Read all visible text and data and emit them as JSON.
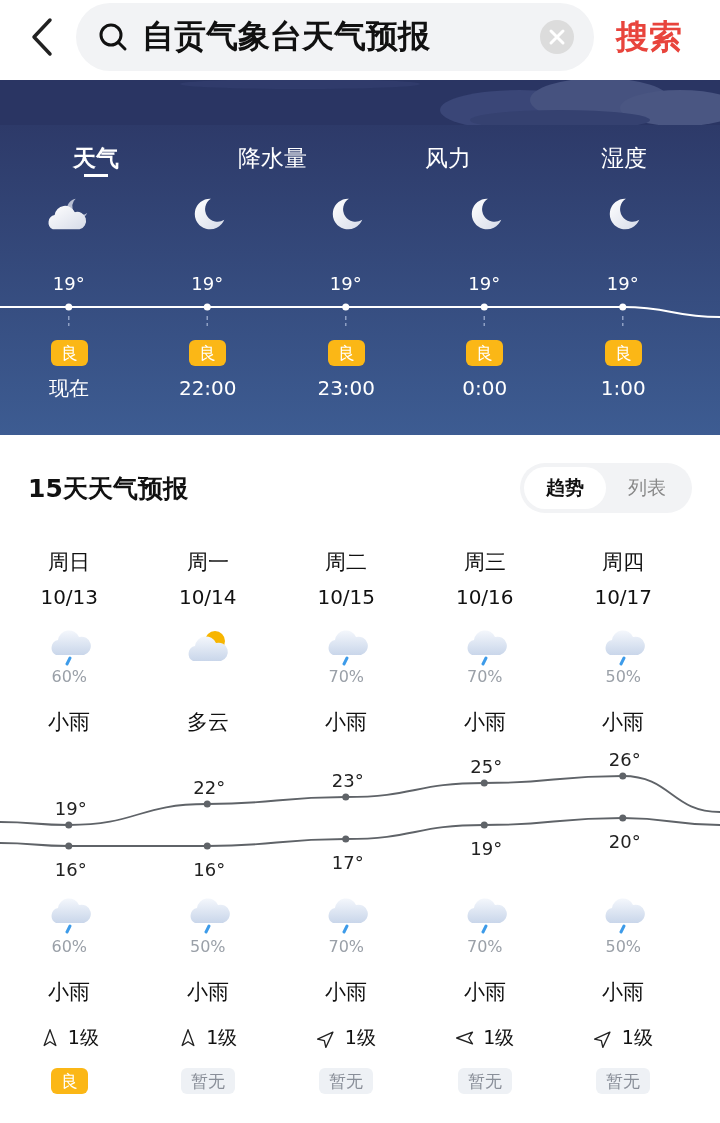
{
  "search_bar": {
    "value": "自贡气象台天气预报",
    "button": "搜索"
  },
  "hourly": {
    "tabs": [
      {
        "label": "天气",
        "selected": true
      },
      {
        "label": "降水量",
        "selected": false
      },
      {
        "label": "风力",
        "selected": false
      },
      {
        "label": "湿度",
        "selected": false
      }
    ],
    "hours": [
      {
        "kind": "cloudy_moon",
        "temp": "19°",
        "aqi": {
          "text": "良",
          "kind": "good"
        },
        "time": "现在"
      },
      {
        "kind": "moon",
        "temp": "19°",
        "aqi": {
          "text": "良",
          "kind": "good"
        },
        "time": "22:00"
      },
      {
        "kind": "moon",
        "temp": "19°",
        "aqi": {
          "text": "良",
          "kind": "good"
        },
        "time": "23:00"
      },
      {
        "kind": "moon",
        "temp": "19°",
        "aqi": {
          "text": "良",
          "kind": "good"
        },
        "time": "0:00"
      },
      {
        "kind": "moon",
        "temp": "19°",
        "aqi": {
          "text": "良",
          "kind": "good"
        },
        "time": "1:00"
      }
    ]
  },
  "forecast": {
    "title": "15天天气预报",
    "view_toggle": [
      {
        "label": "趋势",
        "selected": true
      },
      {
        "label": "列表",
        "selected": false
      }
    ],
    "days": [
      {
        "weekday": "周日",
        "date": "10/13",
        "day": {
          "kind": "rain",
          "pop": "60%",
          "cond": "小雨"
        },
        "high": "19°",
        "low": "16°",
        "night": {
          "kind": "rain",
          "pop": "60%",
          "cond": "小雨"
        },
        "wind": {
          "kind": "up",
          "text": "1级"
        },
        "aqi": {
          "text": "良",
          "kind": "good"
        }
      },
      {
        "weekday": "周一",
        "date": "10/14",
        "day": {
          "kind": "partly_cloudy",
          "cond": "多云"
        },
        "high": "22°",
        "low": "16°",
        "night": {
          "kind": "rain",
          "pop": "50%",
          "cond": "小雨"
        },
        "wind": {
          "kind": "up",
          "text": "1级"
        },
        "aqi": {
          "text": "暂无",
          "kind": "none"
        }
      },
      {
        "weekday": "周二",
        "date": "10/15",
        "day": {
          "kind": "rain",
          "pop": "70%",
          "cond": "小雨"
        },
        "high": "23°",
        "low": "17°",
        "night": {
          "kind": "rain",
          "pop": "70%",
          "cond": "小雨"
        },
        "wind": {
          "kind": "up-right",
          "text": "1级"
        },
        "aqi": {
          "text": "暂无",
          "kind": "none"
        }
      },
      {
        "weekday": "周三",
        "date": "10/16",
        "day": {
          "kind": "rain",
          "pop": "70%",
          "cond": "小雨"
        },
        "high": "25°",
        "low": "19°",
        "night": {
          "kind": "rain",
          "pop": "70%",
          "cond": "小雨"
        },
        "wind": {
          "kind": "left",
          "text": "1级"
        },
        "aqi": {
          "text": "暂无",
          "kind": "none"
        }
      },
      {
        "weekday": "周四",
        "date": "10/17",
        "day": {
          "kind": "rain",
          "pop": "50%",
          "cond": "小雨"
        },
        "high": "26°",
        "low": "20°",
        "night": {
          "kind": "rain",
          "pop": "50%",
          "cond": "小雨"
        },
        "wind": {
          "kind": "up-right",
          "text": "1级"
        },
        "aqi": {
          "text": "暂无",
          "kind": "none"
        }
      }
    ]
  }
}
